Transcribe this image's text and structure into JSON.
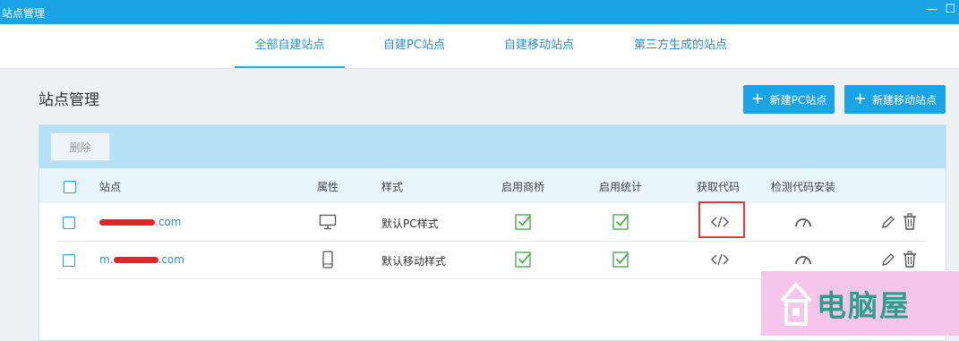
{
  "window": {
    "title": "站点管理",
    "controls": "— ☐"
  },
  "tabs": [
    {
      "label": "全部自建站点",
      "active": true
    },
    {
      "label": "自建PC站点"
    },
    {
      "label": "自建移动站点"
    },
    {
      "label": "第三方生成的站点"
    }
  ],
  "page": {
    "title": "站点管理",
    "new_pc_button": "新建PC站点",
    "new_mobile_button": "新建移动站点"
  },
  "toolbar": {
    "delete_label": "删除"
  },
  "table": {
    "headers": {
      "site": "站点",
      "attribute": "属性",
      "style": "样式",
      "shangqiao": "启用商桥",
      "stats": "启用统计",
      "get_code": "获取代码",
      "check_code": "检测代码安装"
    },
    "rows": [
      {
        "site_prefix": "",
        "site_suffix": ".com",
        "device": "desktop-icon",
        "style": "默认PC样式",
        "shangqiao_enabled": true,
        "stats_enabled": true
      },
      {
        "site_prefix": "m.",
        "site_suffix": ".com",
        "device": "mobile-icon",
        "style": "默认移动样式",
        "shangqiao_enabled": true,
        "stats_enabled": true
      }
    ]
  },
  "watermark": {
    "text": "电脑屋"
  },
  "colors": {
    "accent": "#1aa3e5",
    "check_green": "#4caf50",
    "link": "#2b8fcf",
    "highlight": "#e03b3b"
  }
}
